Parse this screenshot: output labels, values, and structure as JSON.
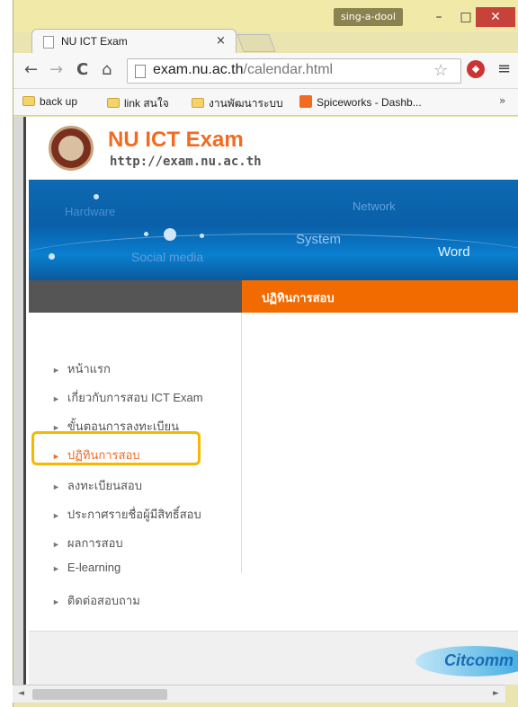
{
  "window": {
    "user": "sing-a-dool",
    "min_label": "–",
    "max_label": "□",
    "close_label": "✕"
  },
  "tab": {
    "title": "NU ICT Exam",
    "close_label": "×"
  },
  "toolbar": {
    "back_glyph": "←",
    "forward_glyph": "→",
    "reload_glyph": "C",
    "home_glyph": "⌂",
    "url_host": "exam.nu.ac.th",
    "url_path": "/calendar.html",
    "star_glyph": "☆",
    "menu_glyph": "≡"
  },
  "bookmarks": {
    "items": [
      {
        "label": "back up",
        "icon": "folder-icon"
      },
      {
        "label": "link สนใจ",
        "icon": "folder-icon"
      },
      {
        "label": "งานพัฒนาระบบ",
        "icon": "folder-icon"
      },
      {
        "label": "Spiceworks - Dashb...",
        "icon": "spiceworks-icon"
      }
    ],
    "overflow": "»"
  },
  "site": {
    "title": "NU ICT Exam",
    "url": "http://exam.nu.ac.th"
  },
  "banner": {
    "words": [
      "Hardware",
      "Network",
      "System",
      "Social media",
      "Word"
    ]
  },
  "content": {
    "heading": "ปฏิทินการสอบ"
  },
  "sidebar": {
    "items": [
      {
        "label": "หน้าแรก",
        "active": false
      },
      {
        "label": "เกี่ยวกับการสอบ ICT Exam",
        "active": false
      },
      {
        "label": "ขั้นตอนการลงทะเบียน",
        "active": false
      },
      {
        "label": "ปฏิทินการสอบ",
        "active": true
      },
      {
        "label": "ลงทะเบียนสอบ",
        "active": false
      },
      {
        "label": "ประกาศรายชื่อผู้มีสิทธิ์สอบ",
        "active": false
      },
      {
        "label": "ผลการสอบ",
        "active": false
      },
      {
        "label": "E-learning",
        "active": false
      },
      {
        "label": "ติดต่อสอบถาม",
        "active": false
      }
    ],
    "arrow": "►"
  },
  "footer": {
    "logo_text": "Citcomm"
  },
  "scrollbar": {
    "left": "◄",
    "right": "►"
  },
  "colors": {
    "accent": "#f26b21",
    "highlight": "#f5b800",
    "banner": "#0d6ab2"
  }
}
